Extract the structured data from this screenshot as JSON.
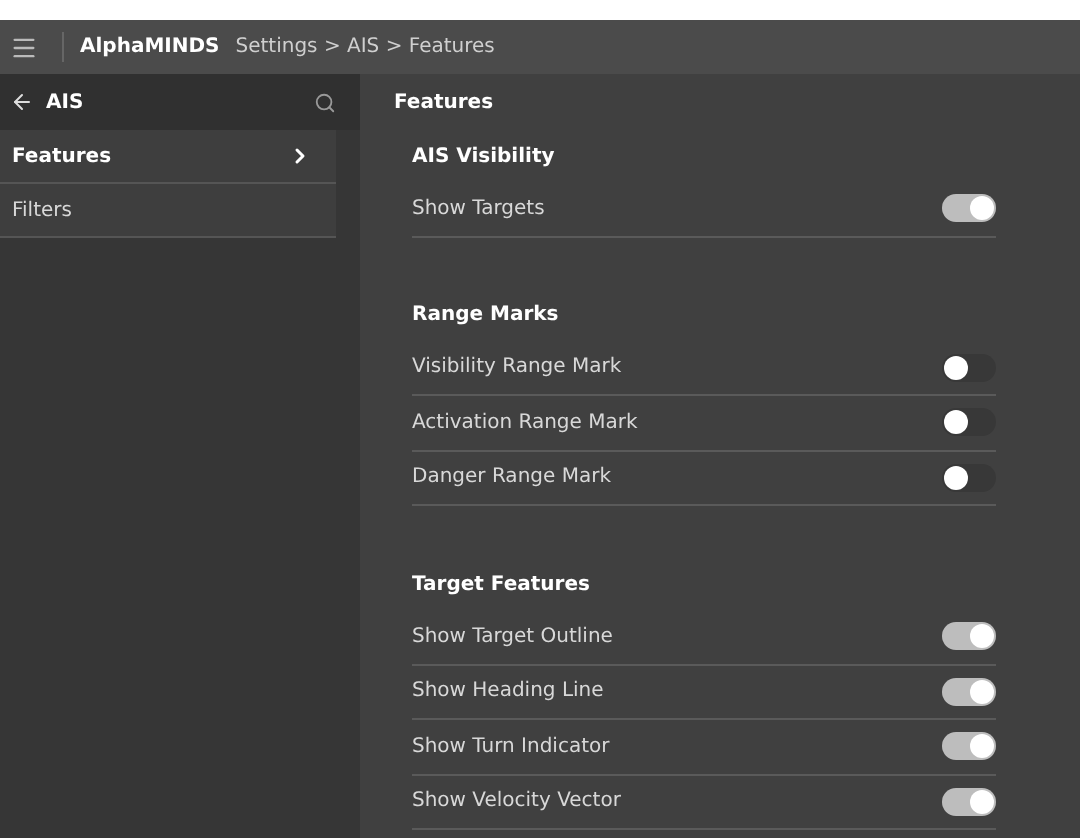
{
  "header": {
    "app_name": "AlphaMINDS",
    "breadcrumb": "Settings > AIS > Features"
  },
  "sidebar": {
    "title": "AIS",
    "items": [
      {
        "label": "Features",
        "selected": true
      },
      {
        "label": "Filters",
        "selected": false
      }
    ]
  },
  "main": {
    "title": "Features",
    "sections": [
      {
        "title": "AIS Visibility",
        "rows": [
          {
            "label": "Show Targets",
            "on": true
          }
        ]
      },
      {
        "title": "Range Marks",
        "rows": [
          {
            "label": "Visibility Range Mark",
            "on": false
          },
          {
            "label": "Activation Range Mark",
            "on": false
          },
          {
            "label": "Danger Range Mark",
            "on": false
          }
        ]
      },
      {
        "title": "Target Features",
        "rows": [
          {
            "label": "Show Target Outline",
            "on": true
          },
          {
            "label": "Show Heading Line",
            "on": true
          },
          {
            "label": "Show Turn Indicator",
            "on": true
          },
          {
            "label": "Show Velocity Vector",
            "on": true
          }
        ]
      }
    ]
  }
}
